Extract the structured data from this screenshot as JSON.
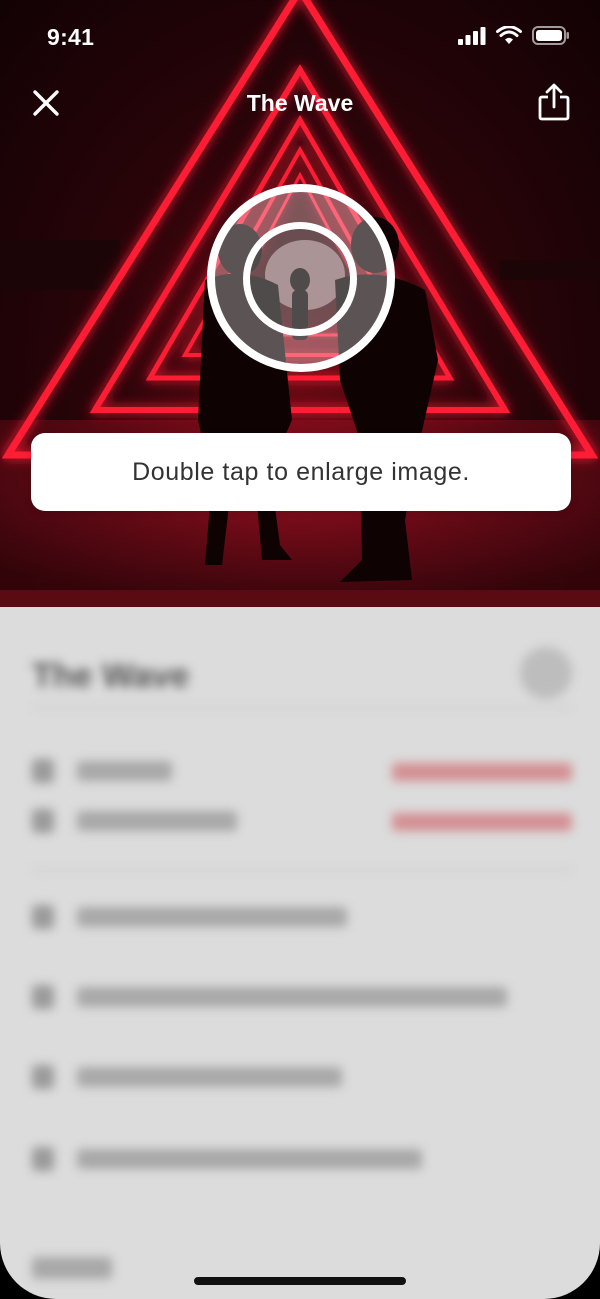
{
  "status_bar": {
    "time": "9:41"
  },
  "nav": {
    "title": "The Wave",
    "close_icon": "close-icon",
    "share_icon": "share-icon"
  },
  "hint": {
    "message": "Double tap to enlarge image.",
    "gesture_icon": "double-tap-gesture-icon"
  },
  "details": {
    "title": "The Wave"
  },
  "colors": {
    "neon": "#ff1a35",
    "photo_dark": "#120204",
    "sheet_bg": "#dcdcdc",
    "link_red": "#d48f93"
  }
}
